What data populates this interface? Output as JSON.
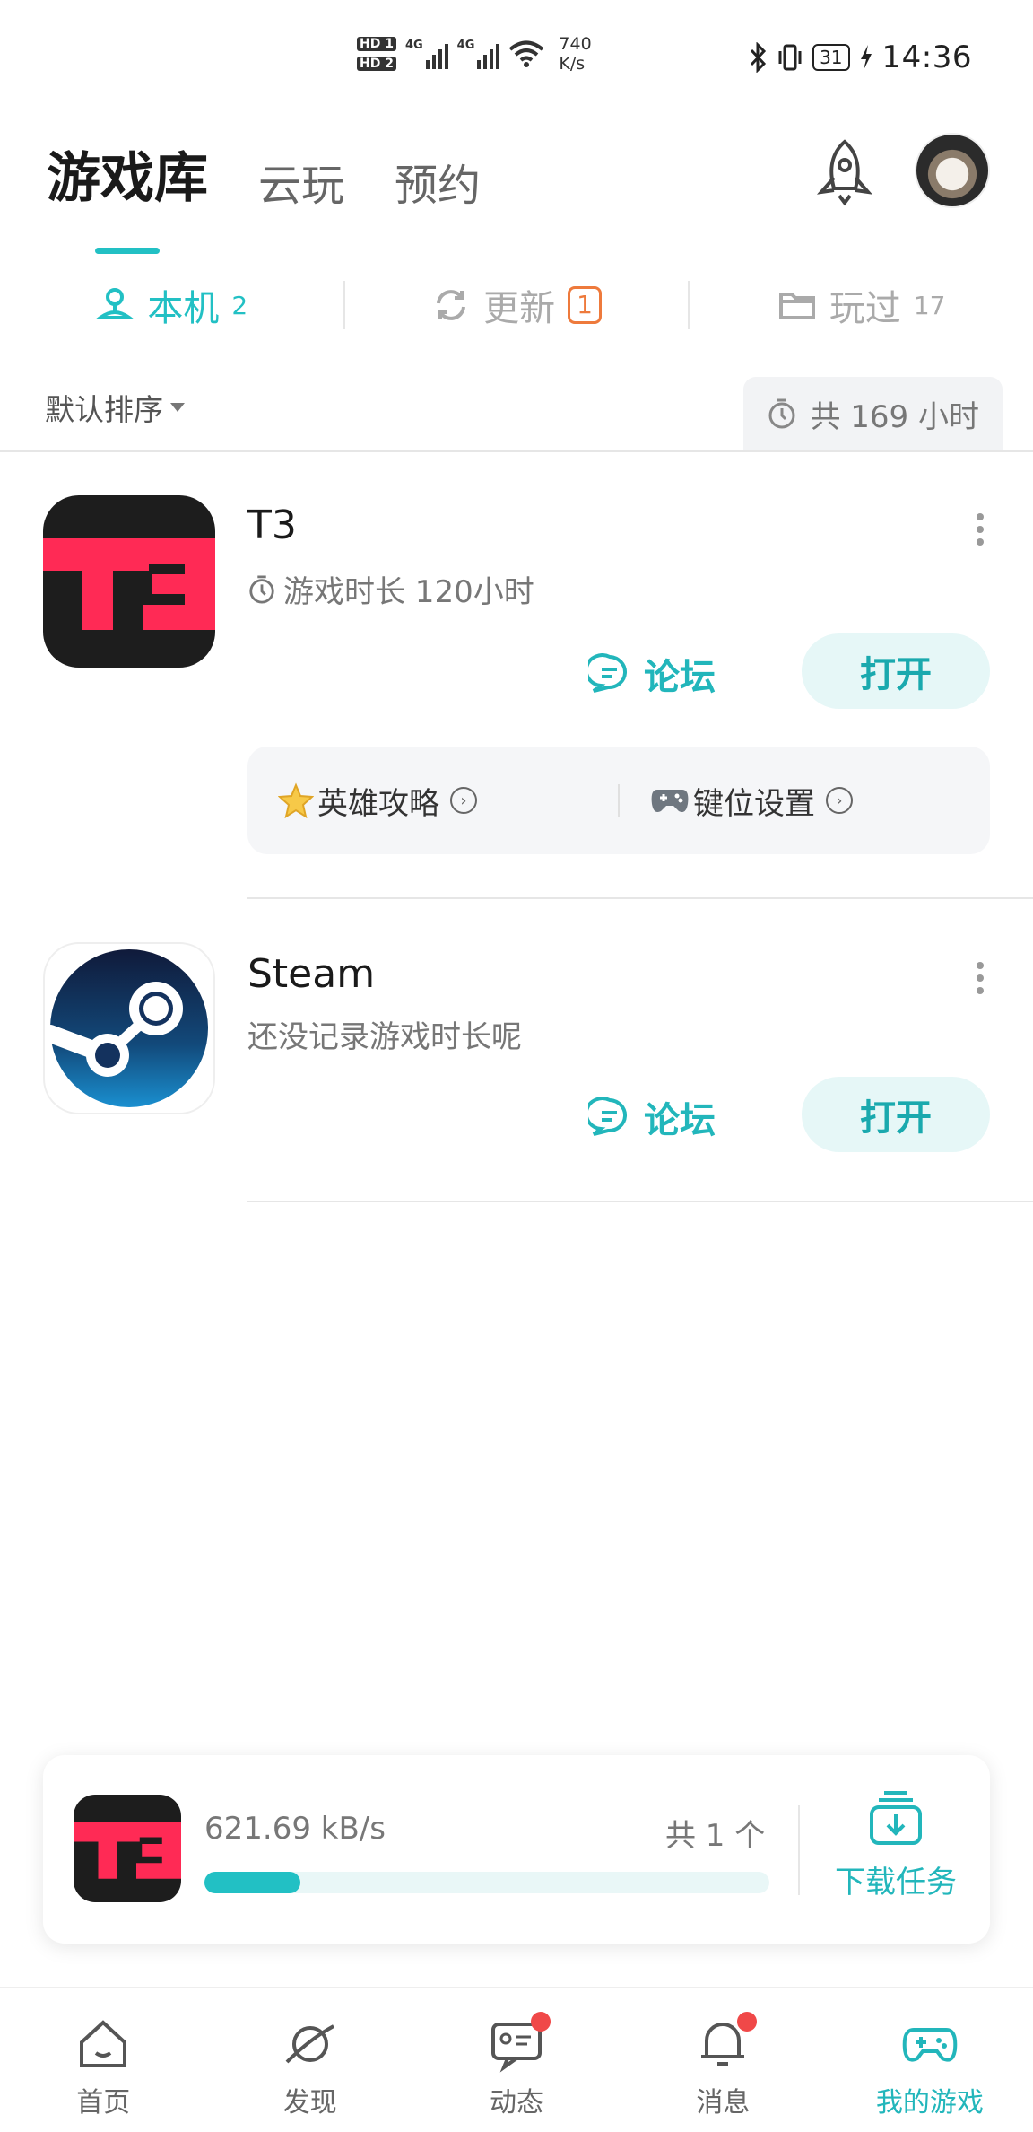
{
  "status_bar": {
    "hd_badges": [
      "HD 1",
      "HD 2"
    ],
    "signals": [
      "4G",
      "4G"
    ],
    "network_speed": "740",
    "network_speed_unit": "K/s",
    "battery": "31",
    "time": "14:36"
  },
  "header": {
    "tabs": [
      {
        "label": "游戏库"
      },
      {
        "label": "云玩"
      },
      {
        "label": "预约"
      }
    ],
    "rocket_icon": "rocket-icon",
    "avatar": "user-avatar"
  },
  "sub_tabs": [
    {
      "label": "本机",
      "count": "2",
      "icon": "device-icon"
    },
    {
      "label": "更新",
      "badge": "1",
      "icon": "refresh-icon"
    },
    {
      "label": "玩过",
      "count": "17",
      "icon": "folder-icon"
    }
  ],
  "sort": {
    "label": "默认排序"
  },
  "total_time": {
    "label": "共 169 小时"
  },
  "games": [
    {
      "name": "T3",
      "meta": "游戏时长 120小时",
      "forum_label": "论坛",
      "open_label": "打开",
      "shortcuts": [
        {
          "label": "英雄攻略",
          "icon": "star-icon"
        },
        {
          "label": "键位设置",
          "icon": "gamepad-icon"
        }
      ]
    },
    {
      "name": "Steam",
      "meta": "还没记录游戏时长呢",
      "forum_label": "论坛",
      "open_label": "打开"
    }
  ],
  "download": {
    "speed": "621.69 kB/s",
    "count": "共 1 个",
    "progress": 0.17,
    "task_label": "下载任务"
  },
  "bottom_nav": [
    {
      "label": "首页",
      "icon": "home-icon"
    },
    {
      "label": "发现",
      "icon": "planet-icon"
    },
    {
      "label": "动态",
      "icon": "message-icon",
      "dot": true
    },
    {
      "label": "消息",
      "icon": "bell-icon",
      "dot": true
    },
    {
      "label": "我的游戏",
      "icon": "gamepad-icon",
      "active": true
    }
  ],
  "colors": {
    "accent": "#22c0c4",
    "update_badge": "#ee7a3c",
    "notification_dot": "#f04848",
    "t3_brand": "#ff2a55"
  }
}
